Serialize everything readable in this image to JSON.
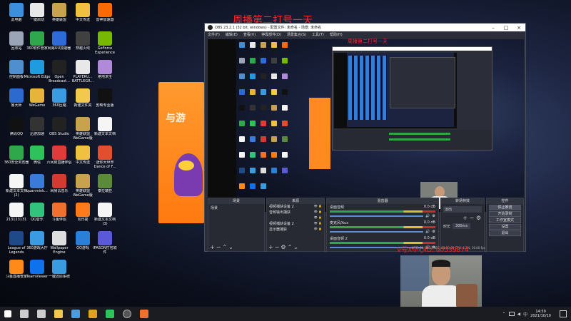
{
  "desktop": {
    "icons": [
      {
        "label": "此电脑",
        "color": "#3b8fdc"
      },
      {
        "label": "一键启动",
        "color": "#e8e8e8"
      },
      {
        "label": "英雄联盟",
        "color": "#c8a24c"
      },
      {
        "label": "中文传送",
        "color": "#f0c040"
      },
      {
        "label": "雷神加速器",
        "color": "#ff6a00"
      },
      {
        "label": "回收站",
        "color": "#9aa6b8"
      },
      {
        "label": "360软件管家",
        "color": "#2ea84a"
      },
      {
        "label": "网易UU加速器",
        "color": "#2e6ad8"
      },
      {
        "label": "穿越火线",
        "color": "#404040"
      },
      {
        "label": "GeForce Experience",
        "color": "#76b900"
      },
      {
        "label": "控制面板",
        "color": "#4f8fd0"
      },
      {
        "label": "Microsoft Edge",
        "color": "#1f9be0"
      },
      {
        "label": "Open Broadcast...",
        "color": "#222"
      },
      {
        "label": "PLAYERU... BATTLEGR...",
        "color": "#e8e8e8"
      },
      {
        "label": "绝地求生",
        "color": "#b08ad8"
      },
      {
        "label": "鲁大师",
        "color": "#2d6ad0"
      },
      {
        "label": "WeGame",
        "color": "#e6b43a"
      },
      {
        "label": "360压缩",
        "color": "#3a9be0"
      },
      {
        "label": "新建文件夹",
        "color": "#f2c94c"
      },
      {
        "label": "剪映专业版",
        "color": "#111"
      },
      {
        "label": "腾讯QQ",
        "color": "#111"
      },
      {
        "label": "迅游加速",
        "color": "#333"
      },
      {
        "label": "OBS Studio",
        "color": "#222"
      },
      {
        "label": "英雄联盟WeGame版",
        "color": "#c8a24c"
      },
      {
        "label": "新建文本文档",
        "color": "#f5f5f5"
      },
      {
        "label": "360安全浏览器",
        "color": "#2ea84a"
      },
      {
        "label": "微信",
        "color": "#2ec35a"
      },
      {
        "label": "六间房直播伴侣",
        "color": "#e03a3a"
      },
      {
        "label": "中文传送",
        "color": "#f0c040"
      },
      {
        "label": "迷你大世界 Dance of F...",
        "color": "#e05030"
      },
      {
        "label": "新建文本文档 (2)",
        "color": "#f5f5f5"
      },
      {
        "label": "quanmink...",
        "color": "#3a7ad8"
      },
      {
        "label": "网易云音乐",
        "color": "#d33a31"
      },
      {
        "label": "英雄联盟WeGame版",
        "color": "#c8a24c"
      },
      {
        "label": "泰拉瑞亚",
        "color": "#5a8a3a"
      },
      {
        "label": "213123131",
        "color": "#f5f5f5"
      },
      {
        "label": "QQ音乐",
        "color": "#31c27c"
      },
      {
        "label": "斗鱼伴侣",
        "color": "#f07030"
      },
      {
        "label": "向日葵",
        "color": "#ff7a1a"
      },
      {
        "label": "新建文本文档 (3)",
        "color": "#f5f5f5"
      },
      {
        "label": "League of Legends",
        "color": "#1f4a8a"
      },
      {
        "label": "360游戏大厅",
        "color": "#3a9be0"
      },
      {
        "label": "Wallpaper Engine",
        "color": "#ddd"
      },
      {
        "label": "QQ游戏",
        "color": "#2a80d8"
      },
      {
        "label": "IPASON打包软件",
        "color": "#5a5ad8"
      },
      {
        "label": "斗鱼直播管家",
        "color": "#ff8a1a"
      },
      {
        "label": "TeamViewer",
        "color": "#0e72ed"
      },
      {
        "label": "一键还原系统",
        "color": "#3a9be0"
      }
    ]
  },
  "overlay": {
    "top_text": "周播第二打号一天",
    "contact_text": "V号X中心ID: 00539874",
    "inner_top_text": "周播第二打号一天"
  },
  "obs": {
    "title": "OBS 23.2.1 (32 bit, windows) - 配置文件: 未命名 - 场景: 未命名",
    "menu": [
      "文件(F)",
      "编辑(E)",
      "查看(V)",
      "停靠部件(D)",
      "场景集合(S)",
      "工具(T)",
      "帮助(H)"
    ],
    "docks": {
      "scenes": {
        "title": "场景",
        "items": [
          "场景"
        ]
      },
      "sources": {
        "title": "来源",
        "items": [
          "视频捕获设备 2",
          "音频输出捕获",
          "",
          "视频捕获设备 2",
          "显示器捕获"
        ]
      },
      "mixer": {
        "title": "混音器",
        "channels": [
          {
            "name": "桌面音频",
            "db": "0.0 dB"
          },
          {
            "name": "麦克风/Aux",
            "db": "0.0 dB"
          },
          {
            "name": "桌面音频 2",
            "db": "0.0 dB"
          }
        ]
      },
      "transitions": {
        "title": "转场特效",
        "type": "淡出",
        "duration_label": "时长",
        "duration": "300ms"
      },
      "controls": {
        "title": "控件",
        "buttons": [
          "停止推流",
          "开始录制",
          "工作室模式",
          "设置",
          "退出"
        ]
      }
    },
    "status": "LIVE: 00:59:23  REC: 00:00:00  CPU: 4.2%, 30.00 fps"
  },
  "taskbar": {
    "time": "14:59",
    "date": "2021/10/10",
    "apps": [
      "start",
      "search",
      "task-view",
      "explorer",
      "store",
      "chrome",
      "wechat",
      "obs",
      "browser"
    ]
  }
}
